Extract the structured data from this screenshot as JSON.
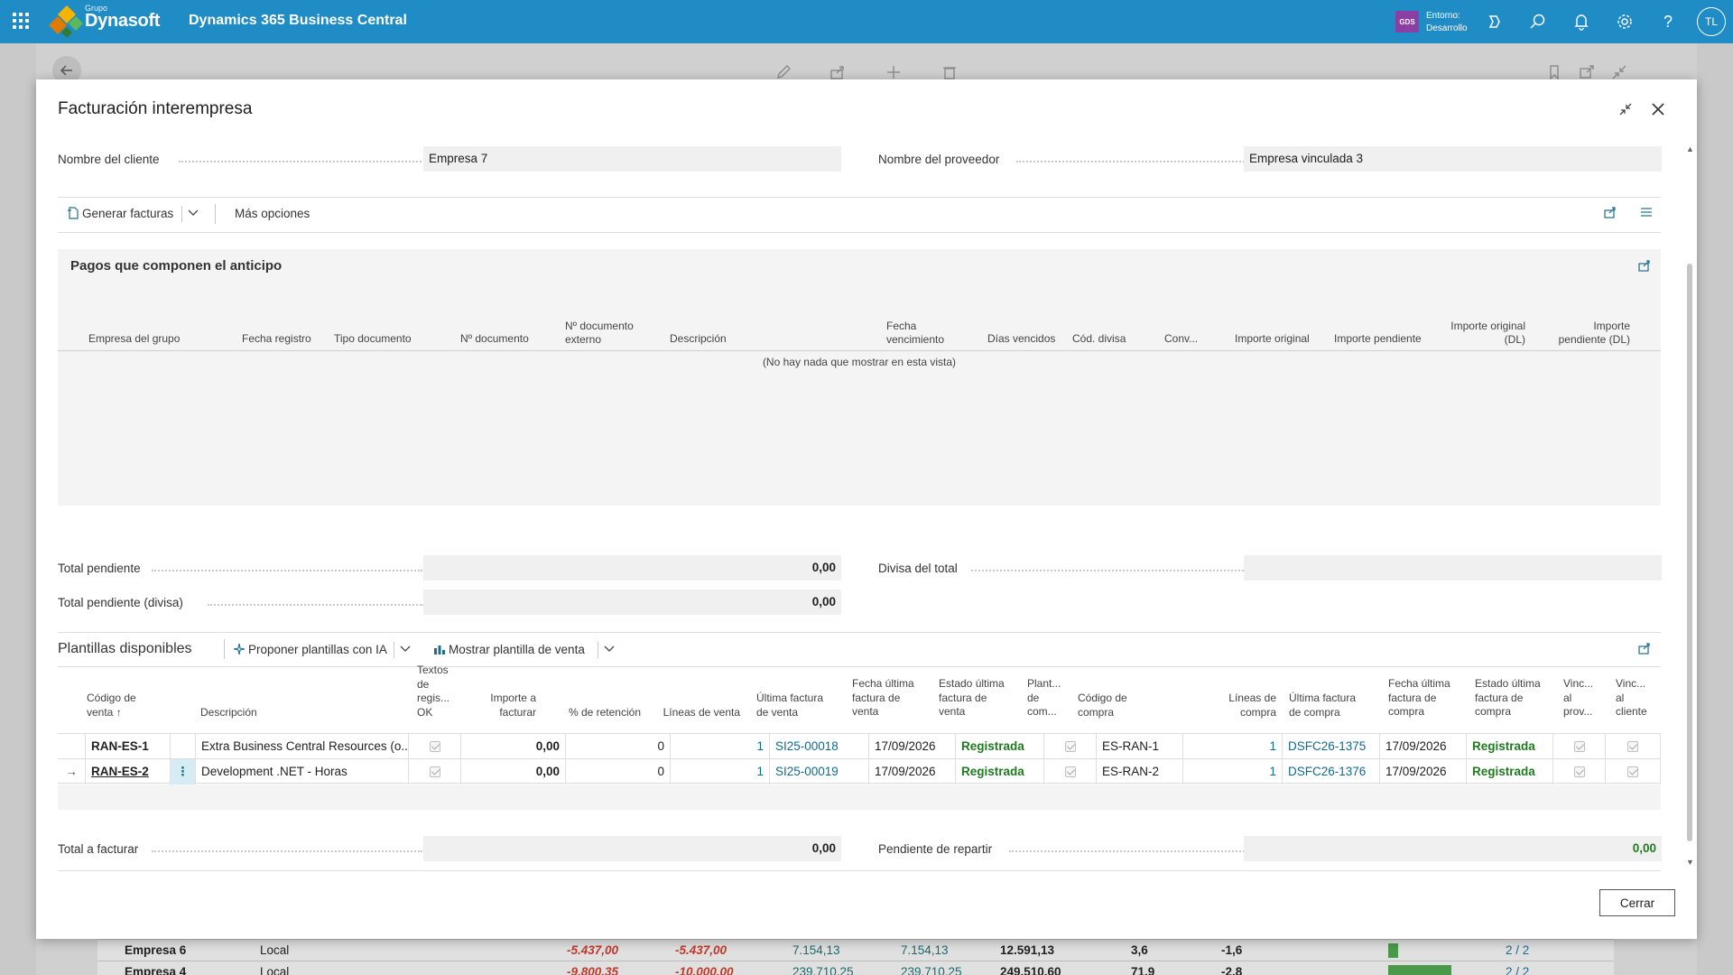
{
  "topbar": {
    "logo_small": "Grupo",
    "logo_name": "Dynasoft",
    "app_title": "Dynamics 365 Business Central",
    "env_badge": "GDS",
    "env_line1": "Entorno:",
    "env_line2": "Desarrollo",
    "avatar": "TL"
  },
  "background": {
    "rows": [
      {
        "name": "Empresa 6",
        "type": "Local",
        "v1": "-5.437,00",
        "v2": "-5.437,00",
        "v3": "7.154,13",
        "v4": "7.154,13",
        "v5": "12.591,13",
        "v6": "3,6",
        "v7": "-1,6",
        "v8": "2 / 2",
        "bar": 0.15
      },
      {
        "name": "Empresa 4",
        "type": "Local",
        "v1": "-9.800,35",
        "v2": "-10.000,00",
        "v3": "239.710,25",
        "v4": "239.710,25",
        "v5": "249.510,60",
        "v6": "71,9",
        "v7": "-2,8",
        "v8": "2 / 2",
        "bar": 1.0
      }
    ]
  },
  "modal": {
    "title": "Facturación interempresa",
    "customer_label": "Nombre del cliente",
    "customer_value": "Empresa 7",
    "vendor_label": "Nombre del proveedor",
    "vendor_value": "Empresa vinculada 3",
    "actions": {
      "generate": "Generar facturas",
      "more": "Más opciones"
    },
    "payments": {
      "title": "Pagos que componen el anticipo",
      "columns": [
        "Empresa del grupo",
        "Fecha registro",
        "Tipo documento",
        "Nº documento",
        "Nº documento externo",
        "Descripción",
        "Fecha vencimiento",
        "Días vencidos",
        "Cód. divisa",
        "Conv...",
        "Importe original",
        "Importe pendiente",
        "Importe original (DL)",
        "Importe pendiente (DL)"
      ],
      "empty": "(No hay nada que mostrar en esta vista)"
    },
    "totals": {
      "pending_label": "Total pendiente",
      "pending_value": "0,00",
      "pending_cur_label": "Total pendiente (divisa)",
      "pending_cur_value": "0,00",
      "currency_label": "Divisa del total",
      "currency_value": ""
    },
    "templates": {
      "title": "Plantillas disponibles",
      "propose": "Proponer plantillas con IA",
      "show": "Mostrar plantilla de venta",
      "columns": {
        "code": "Código de venta",
        "desc": "Descripción",
        "texts": "Textos de regis... OK",
        "amount": "Importe a facturar",
        "retention": "% de retención",
        "sales_lines": "Líneas de venta",
        "last_sales_inv": "Última factura de venta",
        "last_sales_date": "Fecha última factura de venta",
        "last_sales_status": "Estado última factura de venta",
        "purch_tmpl": "Plant... de com...",
        "purch_code": "Código de compra",
        "purch_lines": "Líneas de compra",
        "last_purch_inv": "Última factura de compra",
        "last_purch_date": "Fecha última factura de compra",
        "last_purch_status": "Estado última factura de compra",
        "link_vendor": "Vinc... al prov...",
        "link_customer": "Vinc... al cliente"
      },
      "rows": [
        {
          "code": "RAN-ES-1",
          "desc": "Extra Business Central Resources (o...",
          "amount": "0,00",
          "retention": "0",
          "sales_lines": "1",
          "last_sales_inv": "SI25-00018",
          "last_sales_date": "17/09/2026",
          "last_sales_status": "Registrada",
          "purch_code": "ES-RAN-1",
          "purch_lines": "1",
          "last_purch_inv": "DSFC26-1375",
          "last_purch_date": "17/09/2026",
          "last_purch_status": "Registrada"
        },
        {
          "code": "RAN-ES-2",
          "desc": "Development .NET - Horas",
          "amount": "0,00",
          "retention": "0",
          "sales_lines": "1",
          "last_sales_inv": "SI25-00019",
          "last_sales_date": "17/09/2026",
          "last_sales_status": "Registrada",
          "purch_code": "ES-RAN-2",
          "purch_lines": "1",
          "last_purch_inv": "DSFC26-1376",
          "last_purch_date": "17/09/2026",
          "last_purch_status": "Registrada"
        }
      ]
    },
    "invoice_totals": {
      "to_invoice_label": "Total a facturar",
      "to_invoice_value": "0,00",
      "to_distribute_label": "Pendiente de repartir",
      "to_distribute_value": "0,00"
    },
    "close_label": "Cerrar"
  },
  "colors": {
    "brand": "#1f8cc5",
    "link": "#0f6a8c",
    "posted": "#1f7a1f",
    "negative": "#c0392b"
  }
}
